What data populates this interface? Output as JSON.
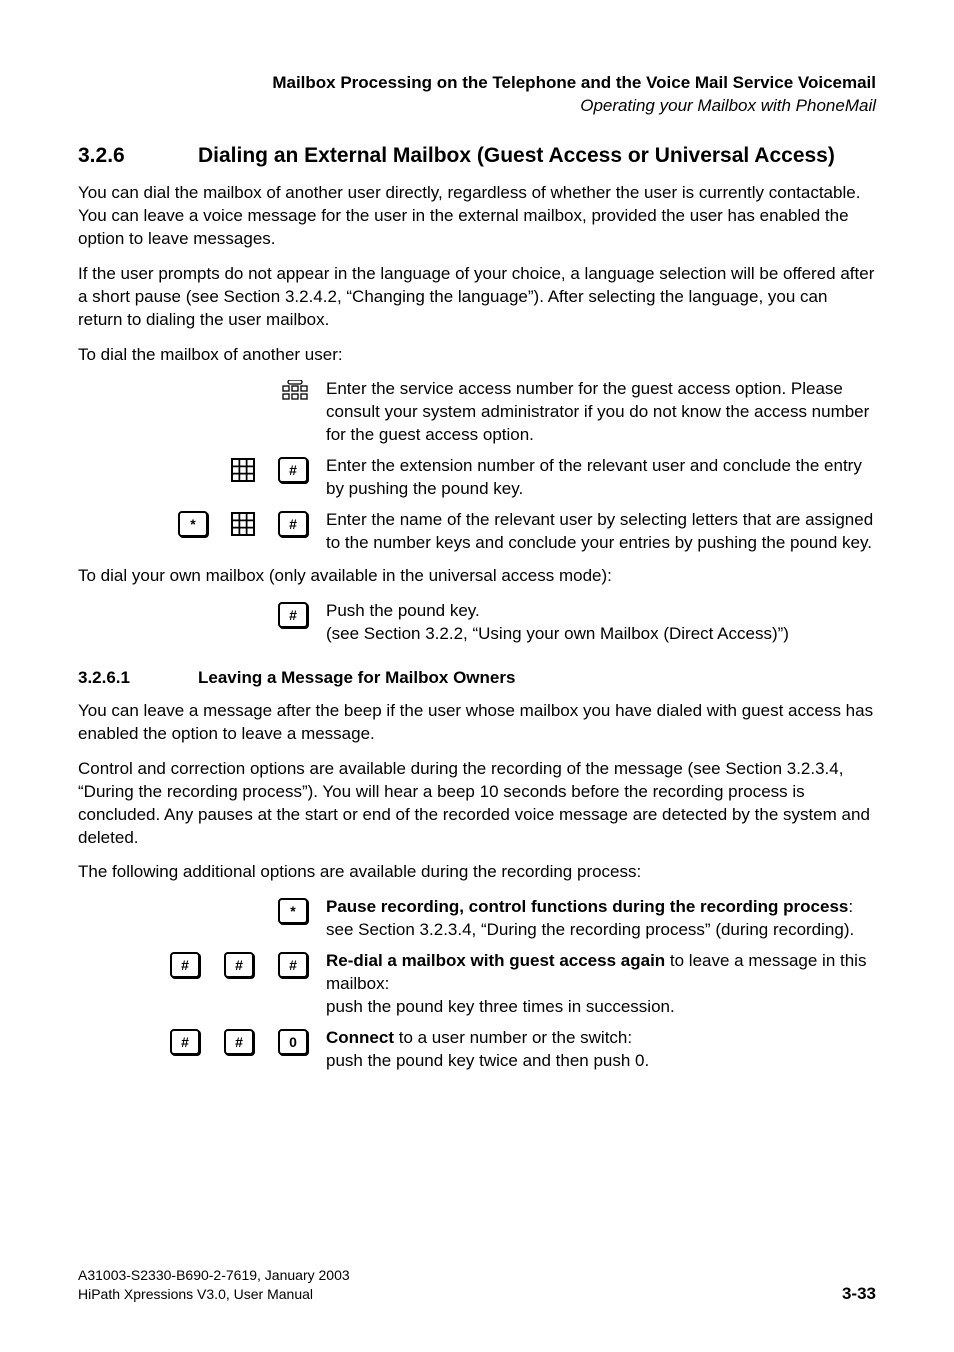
{
  "header": {
    "bold": "Mailbox Processing on the Telephone and the Voice Mail Service Voicemail",
    "italic": "Operating your Mailbox with PhoneMail"
  },
  "section": {
    "num": "3.2.6",
    "title": "Dialing an External Mailbox (Guest Access or Universal Access)"
  },
  "p1": "You can dial the mailbox of another user directly, regardless of whether the user is currently contactable. You can leave a voice message for the user in the external mailbox, provided the user has enabled the option to leave messages.",
  "p2": "If the user prompts do not appear in the language of your choice, a language selection will be offered after a short pause (see Section 3.2.4.2, “Changing the language”). After selecting the language, you can return to dialing the user mailbox.",
  "p3": "To dial the mailbox of another user:",
  "steps1": [
    "Enter the service access number for the guest access option. Please consult your system administrator if you do not know the access number for the guest access option.",
    "Enter the extension number of the relevant user and conclude the entry by pushing the pound key.",
    "Enter the name of the relevant user by selecting letters that are assigned to the number keys and conclude your entries by pushing the pound key."
  ],
  "p4": "To dial your own mailbox (only available in the universal access mode):",
  "pound_step": "Push the pound key.",
  "pound_note": "(see Section 3.2.2, “Using your own Mailbox (Direct Access)”)",
  "sub": {
    "num": "3.2.6.1",
    "title": "Leaving a Message for Mailbox Owners"
  },
  "p5": "You can leave a message after the beep if the user whose mailbox you have dialed with guest access has enabled the option to leave a message.",
  "p6": "Control and correction options are available during the recording of the message (see Section 3.2.3.4, “During the recording process”). You will hear a beep 10 seconds before the recording process is concluded. Any pauses at the start or end of the recorded voice message are detected by the system and deleted.",
  "p7": "The following additional options are available during the recording process:",
  "opts": {
    "pause_bold": "Pause recording, control functions during the recording process",
    "pause_rest": ": see Section 3.2.3.4, “During the recording process” (during recording).",
    "redial_bold": "Re-dial a mailbox with guest access again",
    "redial_rest": " to leave a message in this mailbox:",
    "redial_line2": "push the pound key three times in succession.",
    "connect_bold": "Connect",
    "connect_rest": " to a user number or the switch:",
    "connect_line2": "push the pound key twice and then push 0."
  },
  "keys": {
    "pound": "#",
    "star": "*",
    "zero": "0"
  },
  "footer": {
    "l1": "A31003-S2330-B690-2-7619, January 2003",
    "l2": "HiPath Xpressions V3.0, User Manual",
    "page": "3-33"
  }
}
